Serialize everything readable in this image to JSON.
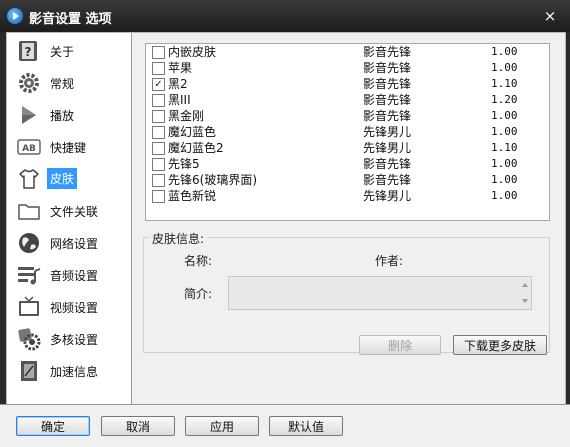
{
  "window": {
    "title": "影音设置 选项",
    "close_glyph": "×"
  },
  "sidebar": {
    "items": [
      {
        "label": "关于",
        "icon": "info-icon"
      },
      {
        "label": "常规",
        "icon": "gear-icon"
      },
      {
        "label": "播放",
        "icon": "play-icon"
      },
      {
        "label": "快捷键",
        "icon": "keyboard-icon"
      },
      {
        "label": "皮肤",
        "icon": "tshirt-icon",
        "active": true
      },
      {
        "label": "文件关联",
        "icon": "folder-icon"
      },
      {
        "label": "网络设置",
        "icon": "globe-icon"
      },
      {
        "label": "音频设置",
        "icon": "audio-icon"
      },
      {
        "label": "视频设置",
        "icon": "tv-icon"
      },
      {
        "label": "多核设置",
        "icon": "multicore-icon"
      },
      {
        "label": "加速信息",
        "icon": "speed-icon"
      }
    ]
  },
  "skins": [
    {
      "name": "内嵌皮肤",
      "author": "影音先锋",
      "version": "1.00",
      "checked": false
    },
    {
      "name": "苹果",
      "author": "影音先锋",
      "version": "1.00",
      "checked": false
    },
    {
      "name": "黑2",
      "author": "影音先锋",
      "version": "1.10",
      "checked": true
    },
    {
      "name": "黑III",
      "author": "影音先锋",
      "version": "1.20",
      "checked": false
    },
    {
      "name": "黑金刚",
      "author": "影音先锋",
      "version": "1.00",
      "checked": false
    },
    {
      "name": "魔幻蓝色",
      "author": "先锋男儿",
      "version": "1.00",
      "checked": false
    },
    {
      "name": "魔幻蓝色2",
      "author": "先锋男儿",
      "version": "1.10",
      "checked": false
    },
    {
      "name": "先锋5",
      "author": "影音先锋",
      "version": "1.00",
      "checked": false
    },
    {
      "name": "先锋6(玻璃界面)",
      "author": "影音先锋",
      "version": "1.00",
      "checked": false
    },
    {
      "name": "蓝色新锐",
      "author": "先锋男儿",
      "version": "1.00",
      "checked": false
    }
  ],
  "info": {
    "legend": "皮肤信息:",
    "name_label": "名称:",
    "author_label": "作者:",
    "desc_label": "简介:"
  },
  "actions": {
    "delete": "删除",
    "download": "下载更多皮肤"
  },
  "footer": {
    "ok": "确定",
    "cancel": "取消",
    "apply": "应用",
    "default": "默认值"
  },
  "colors": {
    "titlebar": "#1c1c1c",
    "selection": "#3399ff",
    "primary_border": "#2b7fd8"
  }
}
